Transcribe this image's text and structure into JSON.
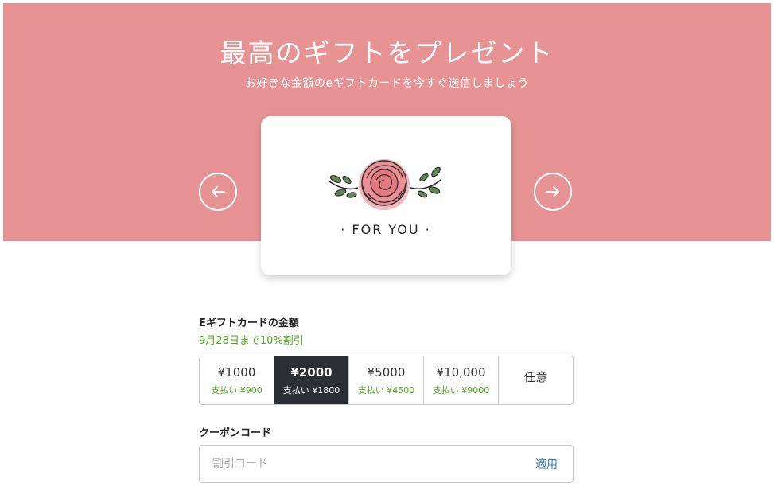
{
  "hero": {
    "title": "最高のギフトをプレゼント",
    "subtitle": "お好きな金額のeギフトカードを今すぐ送信しましょう",
    "background_color": "#e89393"
  },
  "carousel": {
    "prev_icon": "arrow-left-icon",
    "next_icon": "arrow-right-icon",
    "card": {
      "illustration": "rose-flower-icon",
      "text": "· FOR YOU ·"
    }
  },
  "amount": {
    "label": "Eギフトカードの金額",
    "promo": "9月28日まで10%割引",
    "selected_index": 1,
    "options": [
      {
        "amount": "¥1000",
        "pay": "支払い ¥900"
      },
      {
        "amount": "¥2000",
        "pay": "支払い ¥1800"
      },
      {
        "amount": "¥5000",
        "pay": "支払い ¥4500"
      },
      {
        "amount": "¥10,000",
        "pay": "支払い ¥9000"
      },
      {
        "amount": "任意",
        "pay": ""
      }
    ]
  },
  "coupon": {
    "label": "クーポンコード",
    "placeholder": "割引コード",
    "value": "",
    "apply_label": "適用"
  },
  "colors": {
    "accent_green": "#52a51e",
    "selected_dark": "#2b2e33",
    "link_blue": "#2f78c4"
  }
}
